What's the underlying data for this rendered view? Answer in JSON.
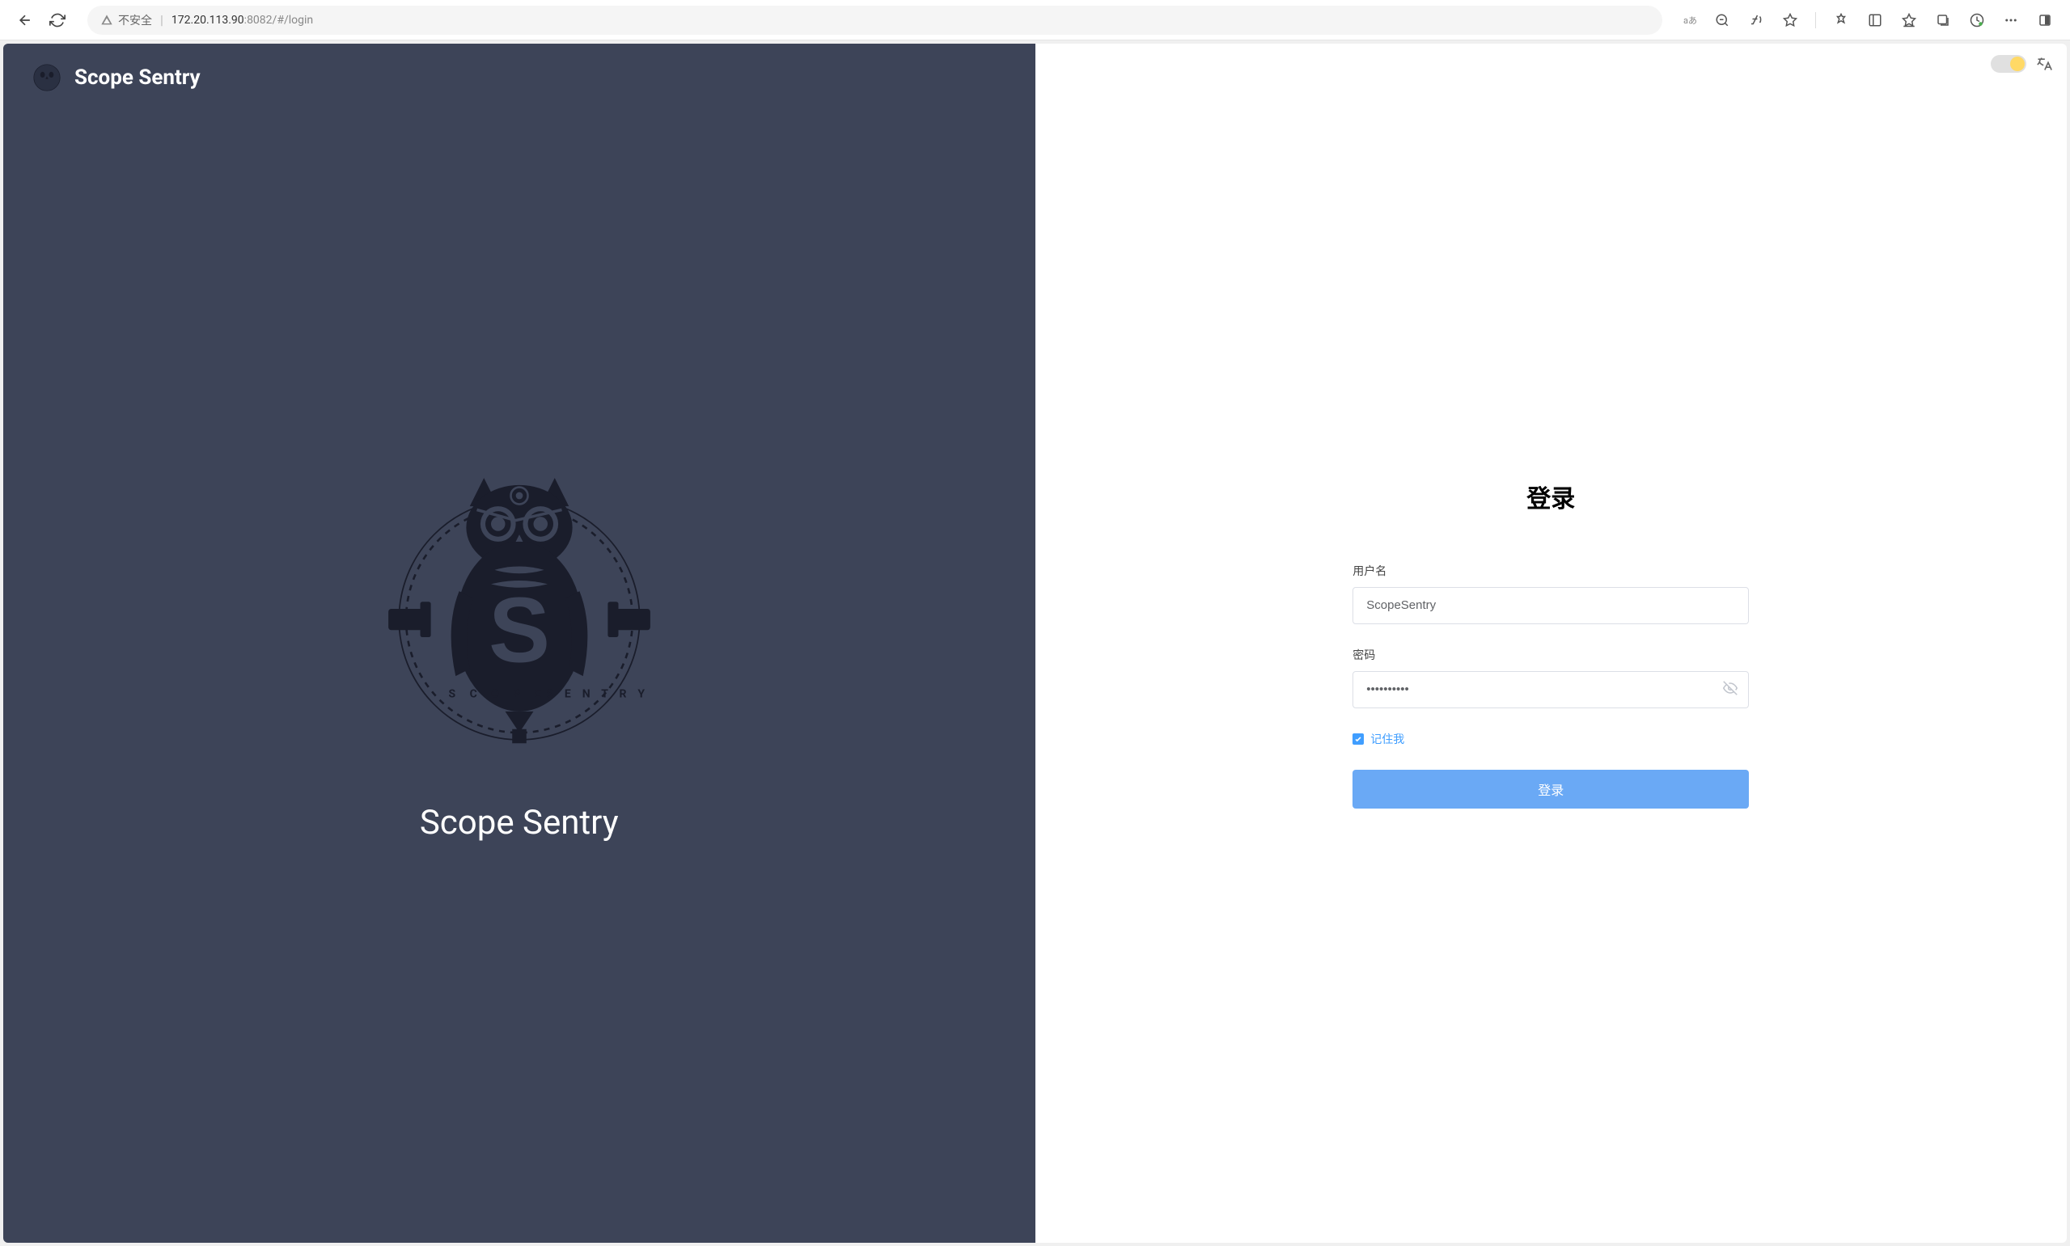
{
  "browser": {
    "security_warning": "不安全",
    "url_host": "172.20.113.90",
    "url_port": ":8082",
    "url_path": "/#/login",
    "lang_indicator": "aあ"
  },
  "left_panel": {
    "header_title": "Scope Sentry",
    "main_title": "Scope Sentry"
  },
  "login": {
    "title": "登录",
    "username_label": "用户名",
    "username_value": "ScopeSentry",
    "password_label": "密码",
    "password_value": "••••••••••",
    "remember_label": "记住我",
    "submit_label": "登录"
  }
}
